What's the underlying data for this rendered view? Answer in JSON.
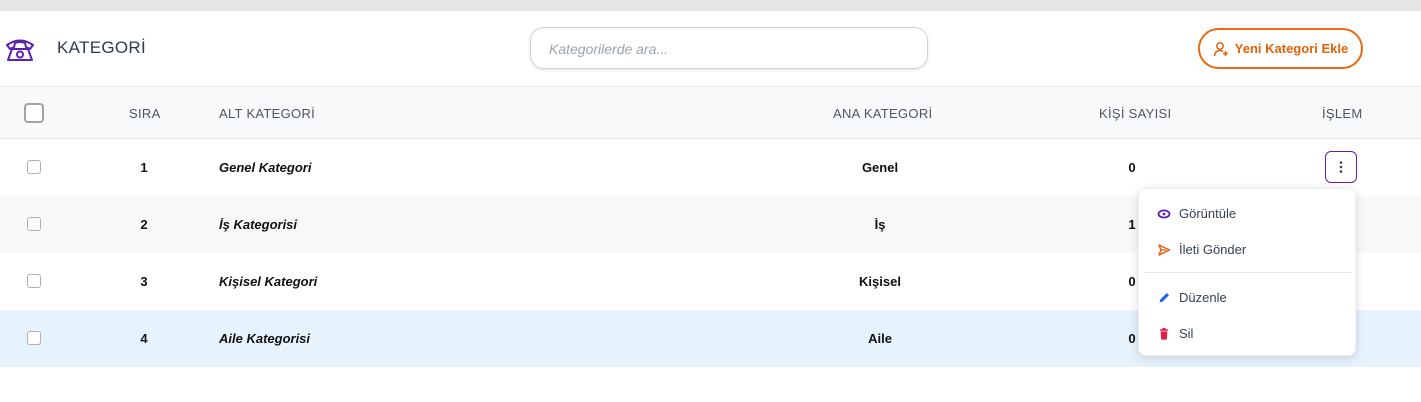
{
  "header": {
    "title": "KATEGORİ",
    "search_placeholder": "Kategorilerde ara...",
    "add_button_label": "Yeni Kategori Ekle"
  },
  "table": {
    "columns": [
      "SIRA",
      "ALT KATEGORİ",
      "ANA KATEGORİ",
      "KİŞİ SAYISI",
      "İŞLEM"
    ],
    "rows": [
      {
        "no": "1",
        "sub": "Genel Kategori",
        "main": "Genel",
        "count": "0"
      },
      {
        "no": "2",
        "sub": "İş Kategorisi",
        "main": "İş",
        "count": "1"
      },
      {
        "no": "3",
        "sub": "Kişisel Kategori",
        "main": "Kişisel",
        "count": "0"
      },
      {
        "no": "4",
        "sub": "Aile Kategorisi",
        "main": "Aile",
        "count": "0"
      }
    ]
  },
  "action_menu": {
    "items": [
      {
        "label": "Görüntüle",
        "icon": "eye-icon",
        "color": "#5b21b6"
      },
      {
        "label": "İleti Gönder",
        "icon": "send-icon",
        "color": "#ea580c"
      },
      {
        "label": "Düzenle",
        "icon": "pencil-icon",
        "color": "#2563eb"
      },
      {
        "label": "Sil",
        "icon": "trash-icon",
        "color": "#e11d48"
      }
    ]
  },
  "colors": {
    "accent_purple": "#5b21b6",
    "accent_orange": "#ea6a12",
    "selected_row": "#e6f2fc"
  }
}
